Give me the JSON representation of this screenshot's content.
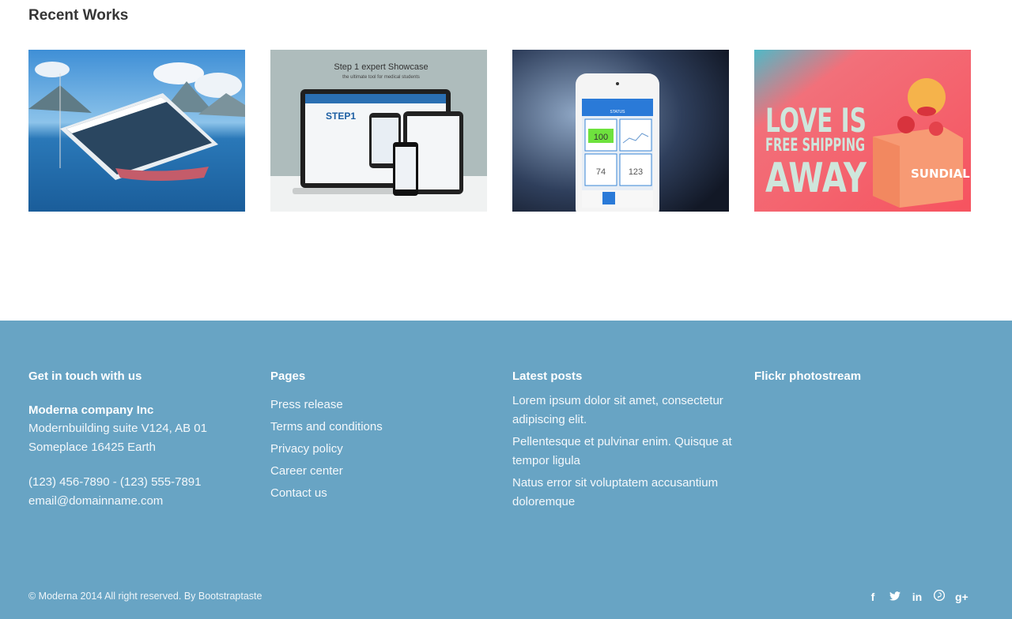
{
  "recent": {
    "title": "Recent Works",
    "items": [
      {
        "icon": "landscape-website-mockup"
      },
      {
        "headline": "Step 1 expert Showcase",
        "subline": "the ultimate tool for medical students",
        "badge": "STEP1"
      },
      {
        "value1": "100",
        "value2": "74",
        "value3": "123",
        "header": "STATUS"
      },
      {
        "line1": "LOVE IS",
        "line2": "FREE SHIPPING",
        "line3": "AWAY",
        "brand": "SUNDIAL"
      }
    ]
  },
  "footer": {
    "contact": {
      "title": "Get in touch with us",
      "company": "Moderna company Inc",
      "address1": "Modernbuilding suite V124, AB 01",
      "address2": "Someplace 16425 Earth",
      "phones": "(123) 456-7890 - (123) 555-7891",
      "email": "email@domainname.com"
    },
    "pages": {
      "title": "Pages",
      "links": [
        "Press release",
        "Terms and conditions",
        "Privacy policy",
        "Career center",
        "Contact us"
      ]
    },
    "posts": {
      "title": "Latest posts",
      "items": [
        "Lorem ipsum dolor sit amet, consectetur adipiscing elit.",
        "Pellentesque et pulvinar enim. Quisque at tempor ligula",
        "Natus error sit voluptatem accusantium doloremque"
      ]
    },
    "flickr": {
      "title": "Flickr photostream"
    },
    "copyright": "© Moderna 2014 All right reserved. By Bootstraptaste",
    "social": [
      {
        "name": "facebook-icon",
        "glyph": "f"
      },
      {
        "name": "twitter-icon",
        "glyph": "t"
      },
      {
        "name": "linkedin-icon",
        "glyph": "in"
      },
      {
        "name": "pinterest-icon",
        "glyph": "p"
      },
      {
        "name": "google-plus-icon",
        "glyph": "g+"
      }
    ],
    "colors": {
      "footer_bg": "#68a4c4"
    }
  }
}
